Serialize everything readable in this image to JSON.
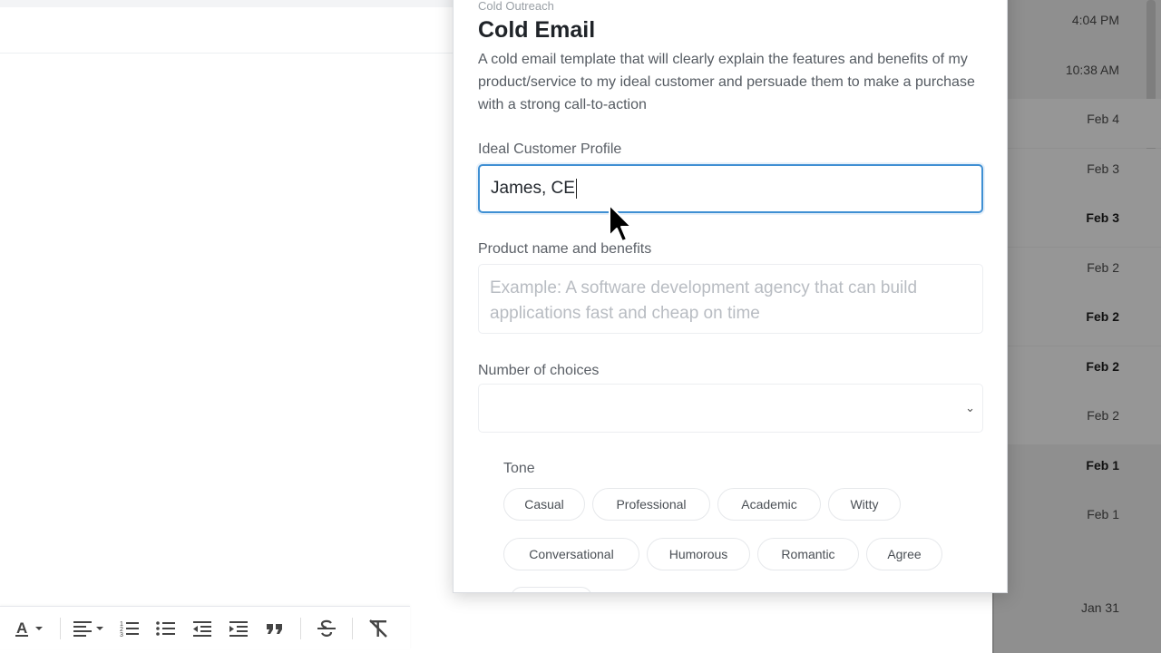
{
  "dialog": {
    "breadcrumb": "Cold Outreach",
    "title": "Cold Email",
    "description": "A cold email template that will clearly explain the features and benefits of my product/service to my ideal customer and persuade them to make a purchase with a strong call-to-action",
    "fields": {
      "icp_label": "Ideal Customer Profile",
      "icp_value": "James, CE",
      "product_label": "Product name and benefits",
      "product_placeholder": "Example: A software development agency that can build applications fast and cheap on time",
      "choices_label": "Number of choices",
      "choices_value": ""
    },
    "tone": {
      "label": "Tone",
      "options": [
        "Casual",
        "Professional",
        "Academic",
        "Witty",
        "Conversational",
        "Humorous",
        "Romantic",
        "Agree"
      ]
    }
  },
  "email_list": {
    "dates": [
      {
        "text": "4:04 PM",
        "bold": false
      },
      {
        "text": "10:38 AM",
        "bold": false
      },
      {
        "text": "Feb 4",
        "bold": false
      },
      {
        "text": "Feb 3",
        "bold": false
      },
      {
        "text": "Feb 3",
        "bold": true
      },
      {
        "text": "Feb 2",
        "bold": false
      },
      {
        "text": "Feb 2",
        "bold": true
      },
      {
        "text": "Feb 2",
        "bold": true
      },
      {
        "text": "Feb 2",
        "bold": false
      },
      {
        "text": "Feb 1",
        "bold": true
      },
      {
        "text": "Feb 1",
        "bold": false
      },
      {
        "text": "Jan 31",
        "bold": false
      }
    ]
  },
  "toolbar": {
    "icons": [
      "text-color-icon",
      "align-icon",
      "numbered-list-icon",
      "bulleted-list-icon",
      "indent-less-icon",
      "indent-more-icon",
      "quote-icon",
      "strikethrough-icon",
      "clear-formatting-icon"
    ]
  },
  "colors": {
    "focus_border": "#3f8fd3",
    "overlay": "#8f8f8f"
  }
}
